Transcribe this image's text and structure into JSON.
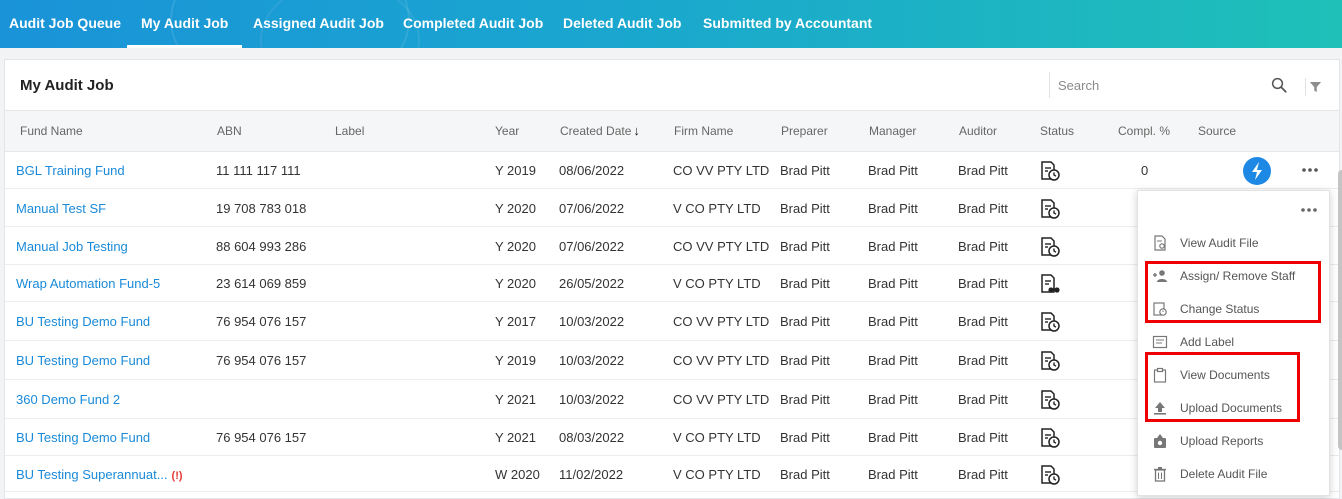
{
  "nav": {
    "tabs": [
      {
        "label": "Audit Job Queue"
      },
      {
        "label": "My Audit Job"
      },
      {
        "label": "Assigned Audit Job"
      },
      {
        "label": "Completed Audit Job"
      },
      {
        "label": "Deleted Audit Job"
      },
      {
        "label": "Submitted by Accountant"
      }
    ],
    "active": "My Audit Job"
  },
  "panel": {
    "title": "My Audit Job",
    "search_placeholder": "Search"
  },
  "table": {
    "columns": [
      "Fund Name",
      "ABN",
      "Label",
      "Year",
      "Created Date",
      "Firm Name",
      "Preparer",
      "Manager",
      "Auditor",
      "Status",
      "Compl. %",
      "Source"
    ],
    "sort_indicator": "↓",
    "rows": [
      {
        "fund": "BGL Training Fund",
        "abn": "11 111 117 111",
        "label": "",
        "year": "Y 2019",
        "date": "08/06/2022",
        "firm": "CO VV PTY LTD",
        "preparer": "Brad Pitt",
        "manager": "Brad Pitt",
        "auditor": "Brad Pitt",
        "status_icon": "status-clock-icon",
        "compl": "0",
        "source_icon": "bgl-source-logo"
      },
      {
        "fund": "Manual Test SF",
        "abn": "19 708 783 018",
        "label": "",
        "year": "Y 2020",
        "date": "07/06/2022",
        "firm": "V CO PTY LTD",
        "preparer": "Brad Pitt",
        "manager": "Brad Pitt",
        "auditor": "Brad Pitt",
        "status_icon": "status-clock-icon",
        "compl": "",
        "source_icon": ""
      },
      {
        "fund": "Manual Job Testing",
        "abn": "88 604 993 286",
        "label": "",
        "year": "Y 2020",
        "date": "07/06/2022",
        "firm": "CO VV PTY LTD",
        "preparer": "Brad Pitt",
        "manager": "Brad Pitt",
        "auditor": "Brad Pitt",
        "status_icon": "status-clock-icon",
        "compl": "",
        "source_icon": ""
      },
      {
        "fund": "Wrap Automation Fund-5",
        "abn": "23 614 069 859",
        "label": "",
        "year": "Y 2020",
        "date": "26/05/2022",
        "firm": "V CO PTY LTD",
        "preparer": "Brad Pitt",
        "manager": "Brad Pitt",
        "auditor": "Brad Pitt",
        "status_icon": "status-view-icon",
        "compl": "",
        "source_icon": ""
      },
      {
        "fund": "BU Testing Demo Fund",
        "abn": "76 954 076 157",
        "label": "",
        "year": "Y 2017",
        "date": "10/03/2022",
        "firm": "CO VV PTY LTD",
        "preparer": "Brad Pitt",
        "manager": "Brad Pitt",
        "auditor": "Brad Pitt",
        "status_icon": "status-clock-icon",
        "compl": "",
        "source_icon": ""
      },
      {
        "fund": "BU Testing Demo Fund",
        "abn": "76 954 076 157",
        "label": "",
        "year": "Y 2019",
        "date": "10/03/2022",
        "firm": "CO VV PTY LTD",
        "preparer": "Brad Pitt",
        "manager": "Brad Pitt",
        "auditor": "Brad Pitt",
        "status_icon": "status-clock-icon",
        "compl": "",
        "source_icon": ""
      },
      {
        "fund": "360 Demo Fund 2",
        "abn": "",
        "label": "",
        "year": "Y 2021",
        "date": "10/03/2022",
        "firm": "CO VV PTY LTD",
        "preparer": "Brad Pitt",
        "manager": "Brad Pitt",
        "auditor": "Brad Pitt",
        "status_icon": "status-clock-icon",
        "compl": "",
        "source_icon": ""
      },
      {
        "fund": "BU Testing Demo Fund",
        "abn": "76 954 076 157",
        "label": "",
        "year": "Y 2021",
        "date": "08/03/2022",
        "firm": "V CO PTY LTD",
        "preparer": "Brad Pitt",
        "manager": "Brad Pitt",
        "auditor": "Brad Pitt",
        "status_icon": "status-clock-icon",
        "compl": "",
        "source_icon": ""
      },
      {
        "fund": "BU Testing Superannuat...",
        "abn": "",
        "label": "",
        "year": "W 2020",
        "date": "11/02/2022",
        "firm": "V CO PTY LTD",
        "preparer": "Brad Pitt",
        "manager": "Brad Pitt",
        "auditor": "Brad Pitt",
        "status_icon": "status-clock-icon",
        "compl": "",
        "source_icon": "",
        "warning": "(!)"
      }
    ]
  },
  "menu": {
    "items": [
      {
        "label": "View Audit File",
        "icon": "view-file-icon"
      },
      {
        "label": "Assign/ Remove Staff",
        "icon": "add-person-icon"
      },
      {
        "label": "Change Status",
        "icon": "change-status-icon"
      },
      {
        "label": "Add Label",
        "icon": "label-icon"
      },
      {
        "label": "View Documents",
        "icon": "clipboard-icon"
      },
      {
        "label": "Upload Documents",
        "icon": "upload-icon"
      },
      {
        "label": "Upload Reports",
        "icon": "upload-report-icon"
      },
      {
        "label": "Delete Audit File",
        "icon": "trash-icon"
      }
    ],
    "highlight_color": "#ee0000"
  },
  "colors": {
    "nav_gradient_start": "#1a93d8",
    "nav_gradient_end": "#1fc0b8",
    "link": "#1a8ad8"
  }
}
